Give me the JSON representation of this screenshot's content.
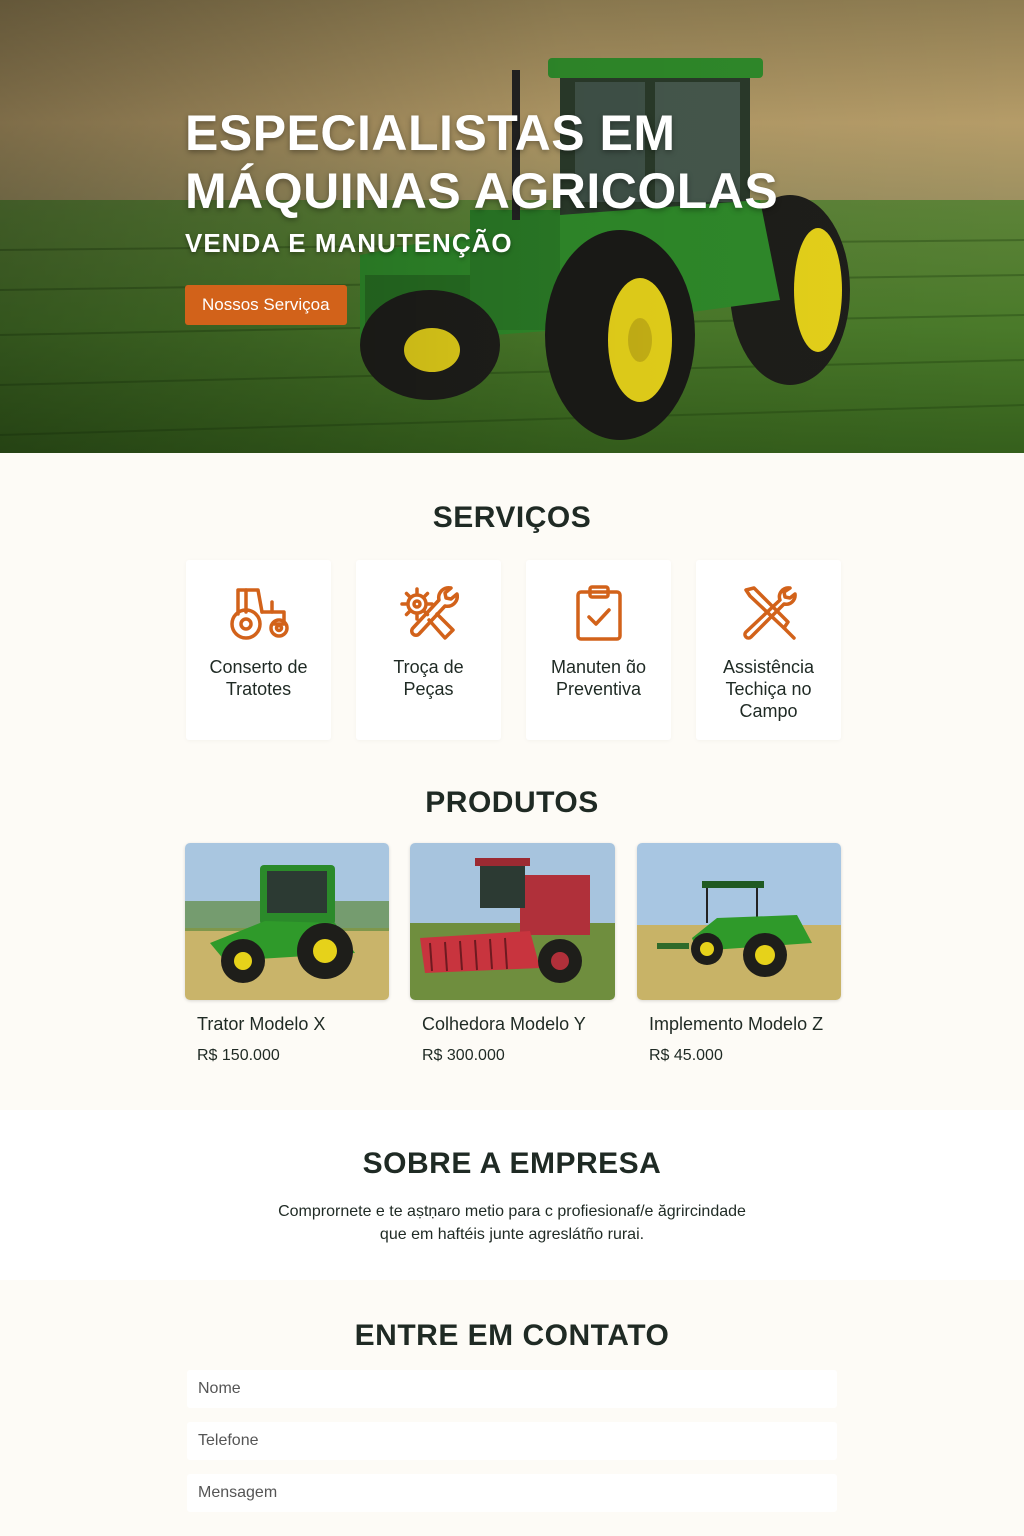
{
  "hero": {
    "title_line1": "ESPECIALISTAS EM",
    "title_line2": "MÁQUINAS AGRICOLAS",
    "subtitle": "VENDA E MANUTENÇÃO",
    "cta_label": "Nossos Serviçoa"
  },
  "services": {
    "title": "SERVIÇOS",
    "items": [
      {
        "line1": "Conserto de",
        "line2": "Tratotes",
        "line3": "",
        "icon": "tractor-icon"
      },
      {
        "line1": "Troça de",
        "line2": "Peças",
        "line3": "",
        "icon": "gear-wrench-icon"
      },
      {
        "line1": "Manuten ɑ̃o",
        "line2": "Preventiva",
        "line3": "",
        "icon": "clipboard-check-icon"
      },
      {
        "line1": "Assistência",
        "line2": "Techiça no",
        "line3": "Campo",
        "icon": "tools-cross-icon"
      }
    ]
  },
  "products": {
    "title": "PRODUTOS",
    "items": [
      {
        "name": "Trator Modelo X",
        "price": "R$ 150.000"
      },
      {
        "name": "Colhedora Modelo Y",
        "price": "R$ 300.000"
      },
      {
        "name": "Implemento Modelo Z",
        "price": "R$ 45.000"
      }
    ]
  },
  "about": {
    "title": "SOBRE A EMPRESA",
    "line1": "Comprornete e te aṣtṇaro metio para c profiesionaf/e ăgrircindade",
    "line2": "que em haftéis junte agreslátño rurai."
  },
  "contact": {
    "title": "ENTRE EM CONTATO",
    "name_placeholder": "Nome",
    "phone_placeholder": "Telefone",
    "message_placeholder": "Mensagem"
  },
  "colors": {
    "accent": "#d2621a",
    "icon": "#d2621a",
    "text": "#1f2a24",
    "background": "#fdfbf6",
    "tractor_green": "#2f8a2a",
    "wheel_yellow": "#e6d21a"
  }
}
